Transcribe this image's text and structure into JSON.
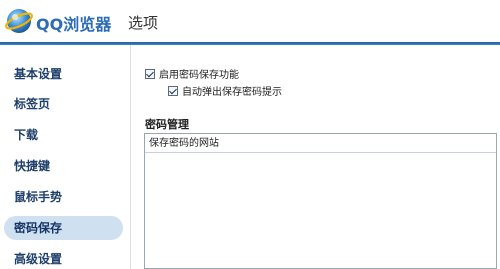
{
  "header": {
    "brand": "QQ浏览器",
    "title": "选项"
  },
  "sidebar": {
    "items": [
      {
        "label": "基本设置"
      },
      {
        "label": "标签页"
      },
      {
        "label": "下载"
      },
      {
        "label": "快捷键"
      },
      {
        "label": "鼠标手势"
      },
      {
        "label": "密码保存",
        "active": true
      },
      {
        "label": "高级设置"
      }
    ]
  },
  "main": {
    "enable_password_save": {
      "label": "启用密码保存功能",
      "checked": true
    },
    "auto_popup_prompt": {
      "label": "自动弹出保存密码提示",
      "checked": true
    },
    "section_title": "密码管理",
    "list_header": "保存密码的网站"
  },
  "colors": {
    "brand_blue": "#2d6db6",
    "header_rule": "#1f5d9e",
    "nav_text": "#1e3f6b",
    "active_bg": "#cfe0f1"
  },
  "icons": {
    "logo": "qq-browser-globe-icon",
    "checkbox": "checkbox-checked-icon"
  }
}
